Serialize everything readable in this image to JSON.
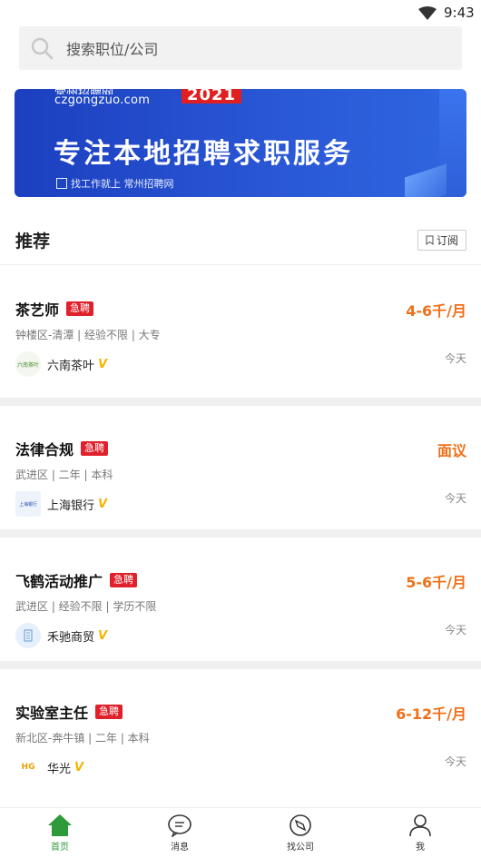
{
  "status": {
    "time": "9:43"
  },
  "search": {
    "placeholder": "搜索职位/公司"
  },
  "banner": {
    "brand_top": "常州招聘网",
    "domain": "czgongzuo.com",
    "year": "2021",
    "headline": "专注本地招聘求职服务",
    "tagline": "找工作就上 常州招聘网"
  },
  "section": {
    "title": "推荐",
    "subscribe_label": "订阅"
  },
  "jobs": [
    {
      "title": "茶艺师",
      "urgent": "急聘",
      "salary": "4-6千/月",
      "meta": "钟楼区-清潭 | 经验不限 | 大专",
      "company": "六南茶叶",
      "logo_text": "六南茶叶",
      "date": "今天"
    },
    {
      "title": "法律合规",
      "urgent": "急聘",
      "salary": "面议",
      "meta": "武进区 | 二年 | 本科",
      "company": "上海银行",
      "logo_text": "上海银行",
      "date": "今天"
    },
    {
      "title": "飞鹤活动推广",
      "urgent": "急聘",
      "salary": "5-6千/月",
      "meta": "武进区 | 经验不限 | 学历不限",
      "company": "禾驰商贸",
      "logo_text": "",
      "date": "今天"
    },
    {
      "title": "实验室主任",
      "urgent": "急聘",
      "salary": "6-12千/月",
      "meta": "新北区-奔牛镇 | 二年 | 本科",
      "company": "华光",
      "logo_text": "HG",
      "date": "今天"
    }
  ],
  "tabs": [
    {
      "label": "首页",
      "icon": "home-icon",
      "active": true
    },
    {
      "label": "消息",
      "icon": "message-icon",
      "active": false
    },
    {
      "label": "找公司",
      "icon": "compass-icon",
      "active": false
    },
    {
      "label": "我",
      "icon": "user-icon",
      "active": false
    }
  ],
  "colors": {
    "accent": "#2e9a3a",
    "salary": "#f07019",
    "urgent": "#e0202a",
    "verified": "#f3b400",
    "banner": "#1b3fbf"
  }
}
